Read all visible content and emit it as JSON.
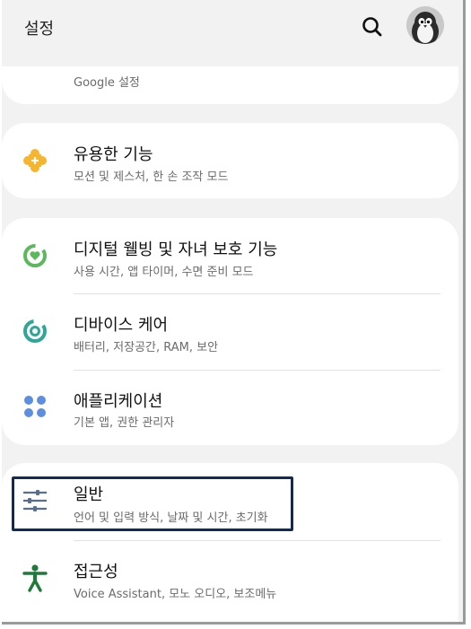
{
  "appbar": {
    "title": "설정",
    "search_icon": "search-icon",
    "avatar_icon": "penguin-avatar"
  },
  "items": [
    {
      "id": "google",
      "title": "",
      "subtitle": "Google 설정",
      "icon": "google-icon",
      "icon_color": "#4285f4"
    },
    {
      "id": "advanced",
      "title": "유용한 기능",
      "subtitle": "모션 및 제스처, 한 손 조작 모드",
      "icon": "puzzle-gear-icon",
      "icon_color": "#f5b52e"
    },
    {
      "id": "wellbeing",
      "title": "디지털 웰빙 및 자녀 보호 기능",
      "subtitle": "사용 시간, 앱 타이머, 수면 준비 모드",
      "icon": "heart-ring-icon",
      "icon_color": "#5cb85c"
    },
    {
      "id": "devicecare",
      "title": "디바이스 케어",
      "subtitle": "배터리, 저장공간, RAM, 보안",
      "icon": "refresh-ring-icon",
      "icon_color": "#2ea79a"
    },
    {
      "id": "apps",
      "title": "애플리케이션",
      "subtitle": "기본 앱, 권한 관리자",
      "icon": "four-dots-icon",
      "icon_color": "#5c8fe0"
    },
    {
      "id": "general",
      "title": "일반",
      "subtitle": "언어 및 입력 방식, 날짜 및 시간, 초기화",
      "icon": "sliders-icon",
      "icon_color": "#5a6f8c"
    },
    {
      "id": "accessibility",
      "title": "접근성",
      "subtitle": "Voice Assistant, 모노 오디오, 보조메뉴",
      "icon": "accessibility-icon",
      "icon_color": "#1f7a3a"
    }
  ]
}
